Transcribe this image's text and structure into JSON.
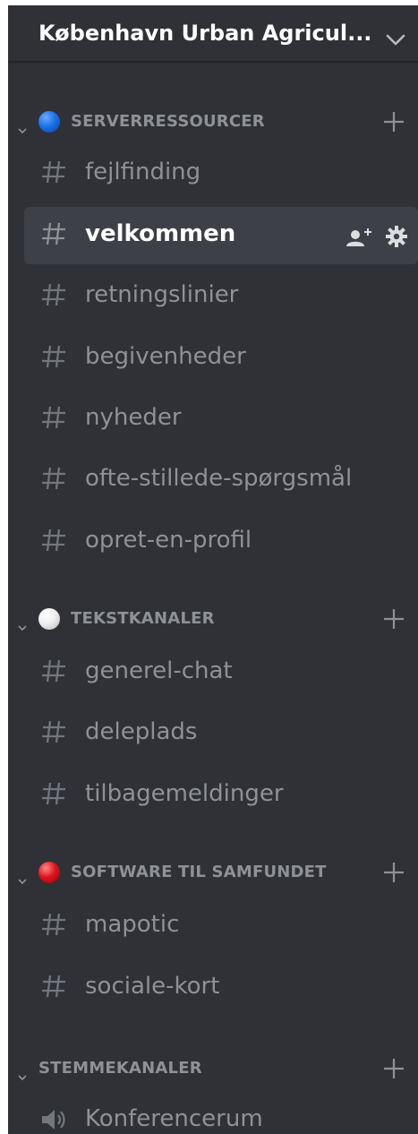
{
  "server": {
    "name": "København Urban Agricul...",
    "dropdown_icon": "chevron-down-icon"
  },
  "categories": [
    {
      "label": "SERVERRESSOURCER",
      "dot_color": "#1a73e8",
      "channels": [
        {
          "name": "fejlfinding"
        },
        {
          "name": "velkommen",
          "selected": true
        },
        {
          "name": "retningslinier"
        },
        {
          "name": "begivenheder"
        },
        {
          "name": "nyheder"
        },
        {
          "name": "ofte-stillede-spørgsmål"
        },
        {
          "name": "opret-en-profil"
        }
      ]
    },
    {
      "label": "TEKSTKANALER",
      "dot_color": "#e8e8e8",
      "channels": [
        {
          "name": "generel-chat"
        },
        {
          "name": "deleplads"
        },
        {
          "name": "tilbagemeldinger"
        }
      ]
    },
    {
      "label": "SOFTWARE TIL SAMFUNDET",
      "dot_color": "#e0141e",
      "channels": [
        {
          "name": "mapotic"
        },
        {
          "name": "sociale-kort"
        }
      ]
    },
    {
      "label": "STEMMEKANALER",
      "channels": [
        {
          "name": "Konferencerum",
          "type": "voice"
        }
      ]
    }
  ],
  "colors": {
    "sidebar_bg": "#2f3136",
    "selected_bg": "#3d4046",
    "muted_text": "#8e9297",
    "active_text": "#ffffff"
  }
}
